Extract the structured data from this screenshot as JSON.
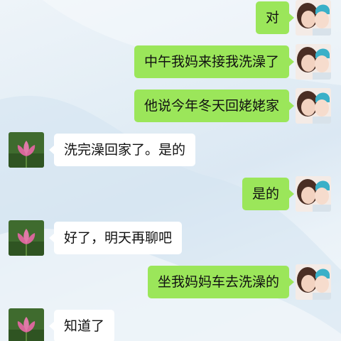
{
  "colors": {
    "sent_bubble": "#9be65a",
    "received_bubble": "#ffffff",
    "text": "#111111"
  },
  "messages": [
    {
      "from": "me",
      "text": "对",
      "avatar": "profile-photo-icon"
    },
    {
      "from": "me",
      "text": "中午我妈来接我洗澡了",
      "avatar": "profile-photo-icon"
    },
    {
      "from": "me",
      "text": "他说今年冬天回姥姥家",
      "avatar": "profile-photo-icon"
    },
    {
      "from": "other",
      "text": "洗完澡回家了。是的",
      "avatar": "lotus-flower-icon"
    },
    {
      "from": "me",
      "text": "是的",
      "avatar": "profile-photo-icon"
    },
    {
      "from": "other",
      "text": "好了，明天再聊吧",
      "avatar": "lotus-flower-icon"
    },
    {
      "from": "me",
      "text": "坐我妈妈车去洗澡的",
      "avatar": "profile-photo-icon"
    },
    {
      "from": "other",
      "text": "知道了",
      "avatar": "lotus-flower-icon"
    }
  ]
}
